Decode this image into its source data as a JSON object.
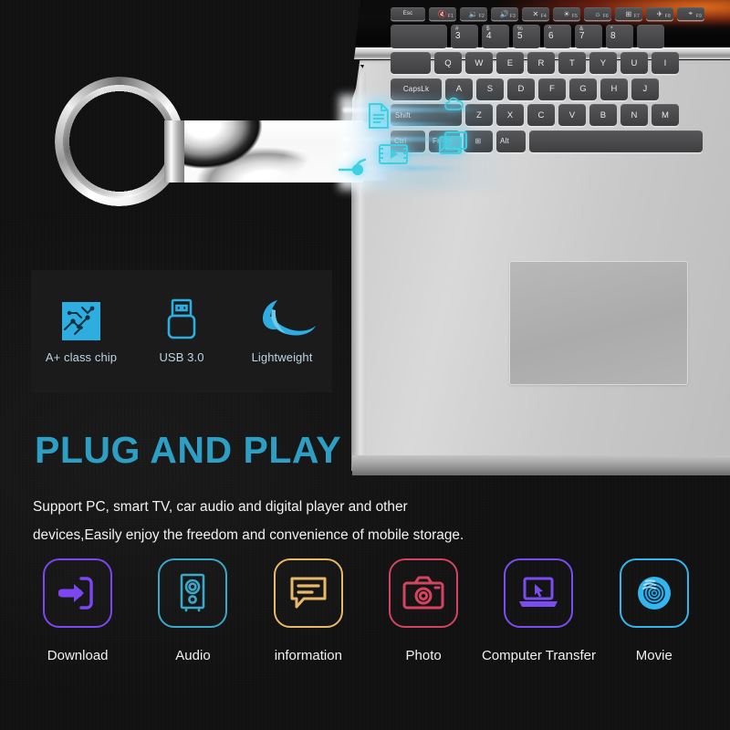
{
  "product": {
    "device_name": "usb-flash-drive",
    "drive_style": "metal-keyring-usb-drive",
    "laptop_brand_keyboard": "laptop-keyboard"
  },
  "headline": {
    "text": "PLUG AND PLAY",
    "color": "#2e9fc4"
  },
  "body_copy": {
    "line1": "Support PC, smart TV, car audio and digital player and other",
    "line2": "devices,Easily enjoy the freedom and convenience of mobile storage."
  },
  "feature_panel": {
    "background": "#1b1b1b",
    "accent": "#2eaee0",
    "items": [
      {
        "label": "A+ class chip",
        "icon": "circuit-chip-icon"
      },
      {
        "label": "USB 3.0",
        "icon": "usb-connector-icon"
      },
      {
        "label": "Lightweight",
        "icon": "feather-icon"
      }
    ]
  },
  "use_cases": {
    "items": [
      {
        "label": "Download",
        "icon": "download-arrow-icon",
        "color": "#7c46f0"
      },
      {
        "label": "Audio",
        "icon": "speaker-icon",
        "color": "#3aa8c8"
      },
      {
        "label": "information",
        "icon": "chat-bubble-icon",
        "color": "#e8b968"
      },
      {
        "label": "Photo",
        "icon": "camera-icon",
        "color": "#d4435f"
      },
      {
        "label": "Computer Transfer",
        "icon": "laptop-cursor-icon",
        "color": "#7b4df0"
      },
      {
        "label": "Movie",
        "icon": "disc-icon",
        "color": "#31b6ef"
      }
    ]
  },
  "transfer_graphic": {
    "description": "data-transfer-beam",
    "file_icons": [
      {
        "icon": "document-file-icon"
      },
      {
        "icon": "video-film-icon"
      },
      {
        "icon": "image-photo-icon"
      },
      {
        "icon": "music-note-icon"
      },
      {
        "icon": "cloud-icon"
      }
    ],
    "beam_color": "#5ad7f5"
  },
  "keyboard": {
    "fn_row": [
      "Esc",
      "F1",
      "F2",
      "F3",
      "F4",
      "F5",
      "F6",
      "F7",
      "F8",
      "F9"
    ],
    "num_row": [
      "3",
      "4",
      "5",
      "6",
      "7",
      "8"
    ],
    "num_upper": [
      "#",
      "$",
      "%",
      "^",
      "&",
      "*"
    ],
    "qwerty_row": [
      "Q",
      "W",
      "E",
      "R",
      "T",
      "Y",
      "U",
      "I"
    ],
    "home_row": [
      "CapsLk",
      "A",
      "S",
      "D",
      "F",
      "G",
      "H",
      "J"
    ],
    "shift_row": [
      "Shift",
      "Z",
      "X",
      "C",
      "V",
      "B",
      "N",
      "M"
    ],
    "bottom_row": [
      "Ctrl",
      "Fn",
      "Win",
      "Alt"
    ]
  },
  "background": {
    "page": "#141414"
  }
}
